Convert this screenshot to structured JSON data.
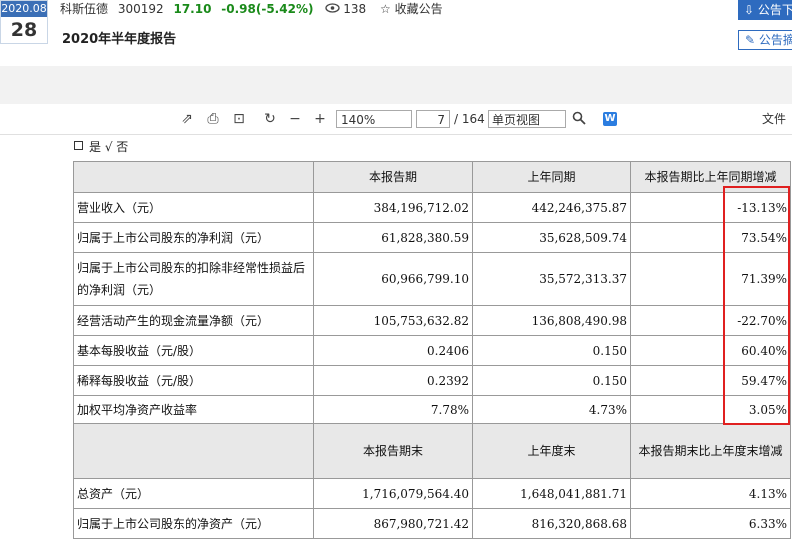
{
  "header": {
    "date_month": "2020.08",
    "date_day": "28",
    "stock_name": "科斯伍德",
    "stock_code": "300192",
    "price": "17.10",
    "change": "-0.98(-5.42%)",
    "views": "138",
    "favorite_label": "收藏公告",
    "doc_title": "2020年半年度报告",
    "announcement_button": "公告下",
    "announcement_button2": "公告摘"
  },
  "toolbar": {
    "zoom": "140%",
    "page_current": "7",
    "page_total": "/ 164",
    "view_mode": "单页视图",
    "file_label": "文件"
  },
  "doc": {
    "checkbox_text": "是 √ 否",
    "table": {
      "header1": [
        "",
        "本报告期",
        "上年同期",
        "本报告期比上年同期增减"
      ],
      "rows1": [
        [
          "营业收入（元）",
          "384,196,712.02",
          "442,246,375.87",
          "-13.13%"
        ],
        [
          "归属于上市公司股东的净利润（元）",
          "61,828,380.59",
          "35,628,509.74",
          "73.54%"
        ],
        [
          "归属于上市公司股东的扣除非经常性损益后的净利润（元）",
          "60,966,799.10",
          "35,572,313.37",
          "71.39%"
        ],
        [
          "经营活动产生的现金流量净额（元）",
          "105,753,632.82",
          "136,808,490.98",
          "-22.70%"
        ],
        [
          "基本每股收益（元/股）",
          "0.2406",
          "0.150",
          "60.40%"
        ],
        [
          "稀释每股收益（元/股）",
          "0.2392",
          "0.150",
          "59.47%"
        ],
        [
          "加权平均净资产收益率",
          "7.78%",
          "4.73%",
          "3.05%"
        ]
      ],
      "header2": [
        "",
        "本报告期末",
        "上年度末",
        "本报告期末比上年度末增减"
      ],
      "rows2": [
        [
          "总资产（元）",
          "1,716,079,564.40",
          "1,648,041,881.71",
          "4.13%"
        ],
        [
          "归属于上市公司股东的净资产（元）",
          "867,980,721.42",
          "816,320,868.68",
          "6.33%"
        ]
      ]
    }
  }
}
